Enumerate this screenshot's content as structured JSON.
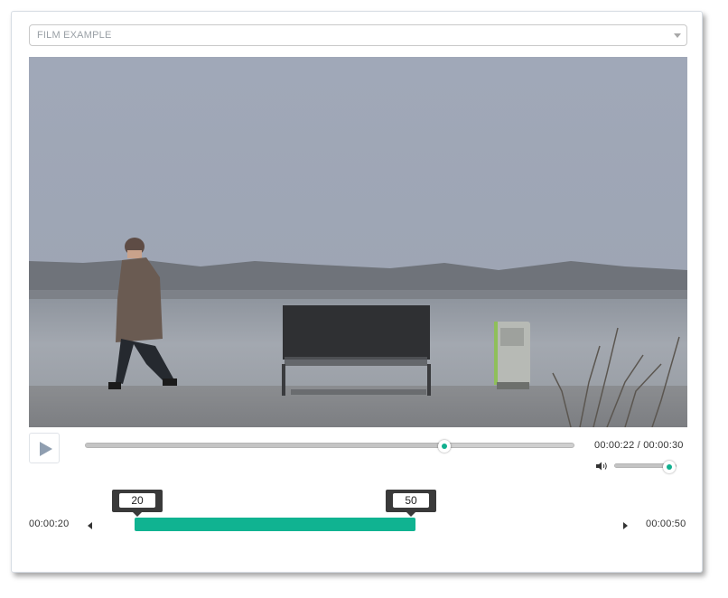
{
  "film_select": {
    "selected": "FILM EXAMPLE"
  },
  "player": {
    "current_time": "00:00:22",
    "duration": "00:00:30",
    "time_separator": " / ",
    "progress_fraction": 0.733,
    "volume_fraction": 1.0
  },
  "trim": {
    "start_time": "00:00:20",
    "end_time": "00:00:50",
    "range_min": 0,
    "range_max": 100,
    "low_value": "20",
    "high_value": "50"
  },
  "colors": {
    "accent": "#10b391",
    "handle_bg": "#3a3a3a",
    "track": "#cfcfcf",
    "play_icon": "#8f9eb0"
  },
  "icons": {
    "play": "play-icon",
    "volume": "volume-icon",
    "dropdown": "chevron-down-icon",
    "nudge_left": "caret-left-icon",
    "nudge_right": "caret-right-icon"
  }
}
